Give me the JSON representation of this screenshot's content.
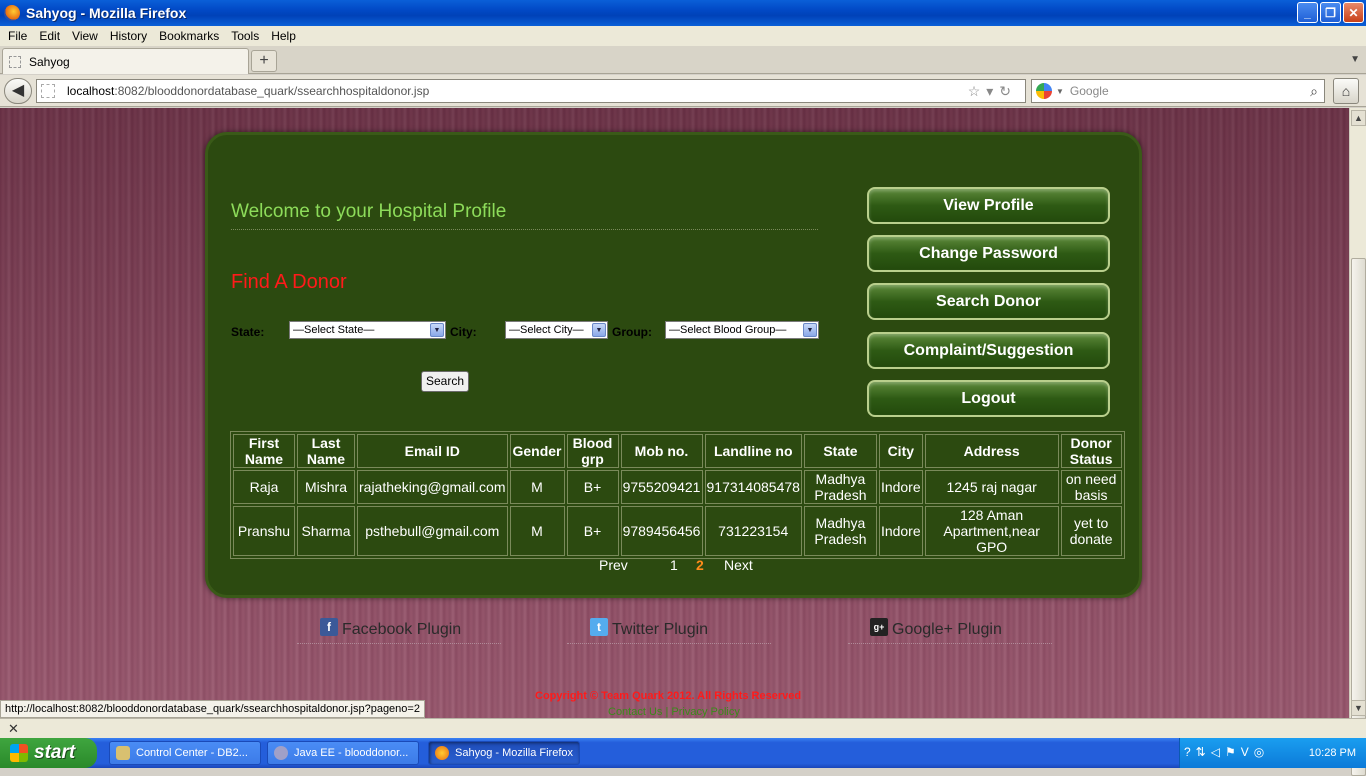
{
  "window": {
    "title": "Sahyog - Mozilla Firefox"
  },
  "menu": [
    "File",
    "Edit",
    "View",
    "History",
    "Bookmarks",
    "Tools",
    "Help"
  ],
  "tab": {
    "label": "Sahyog"
  },
  "url": {
    "host": "localhost",
    "rest": ":8082/blooddonordatabase_quark/ssearchhospitaldonor.jsp"
  },
  "search": {
    "placeholder": "Google"
  },
  "page": {
    "welcome": "Welcome to your Hospital Profile",
    "find_donor": "Find A Donor",
    "filters": {
      "state_label": "State:",
      "state_value": "—Select State—",
      "city_label": "City:",
      "city_value": "—Select City—",
      "group_label": "Group:",
      "group_value": "—Select Blood Group—",
      "search_label": "Search"
    },
    "sidebar": [
      {
        "label": "View Profile"
      },
      {
        "label": "Change Password"
      },
      {
        "label": "Search Donor"
      },
      {
        "label": "Complaint/Suggestion"
      },
      {
        "label": "Logout"
      }
    ],
    "table": {
      "headers": [
        "First Name",
        "Last Name",
        "Email ID",
        "Gender",
        "Blood grp",
        "Mob no.",
        "Landline no",
        "State",
        "City",
        "Address",
        "Donor Status"
      ],
      "rows": [
        [
          "Raja",
          "Mishra",
          "rajatheking@gmail.com",
          "M",
          "B+",
          "9755209421",
          "917314085478",
          "Madhya Pradesh",
          "Indore",
          "1245 raj nagar",
          "on need basis"
        ],
        [
          "Pranshu",
          "Sharma",
          "psthebull@gmail.com",
          "M",
          "B+",
          "9789456456",
          "731223154",
          "Madhya Pradesh",
          "Indore",
          "128 Aman Apartment,near GPO",
          "yet to donate"
        ]
      ]
    },
    "pager": {
      "prev": "Prev",
      "page1": "1",
      "page2": "2",
      "next": "Next"
    },
    "plugins": {
      "facebook": "Facebook Plugin",
      "twitter": "Twitter Plugin",
      "google": "Google+ Plugin"
    },
    "footer": {
      "copyright": "Copyright © Team Quark 2012. All Rights Reserved",
      "contact": "Contact Us | Privacy Policy"
    }
  },
  "status": {
    "url": "http://localhost:8082/blooddonordatabase_quark/ssearchhospitaldonor.jsp?pageno=2"
  },
  "taskbar": {
    "start": "start",
    "tasks": [
      {
        "label": "Control Center - DB2..."
      },
      {
        "label": "Java EE - blooddonor..."
      },
      {
        "label": "Sahyog - Mozilla Firefox"
      }
    ],
    "clock": "10:28 PM"
  },
  "colors": {
    "panel": "#2c4a10",
    "welcome": "#8ddc5a",
    "find": "#ff1a1a",
    "current_page": "#ff8c1a"
  }
}
